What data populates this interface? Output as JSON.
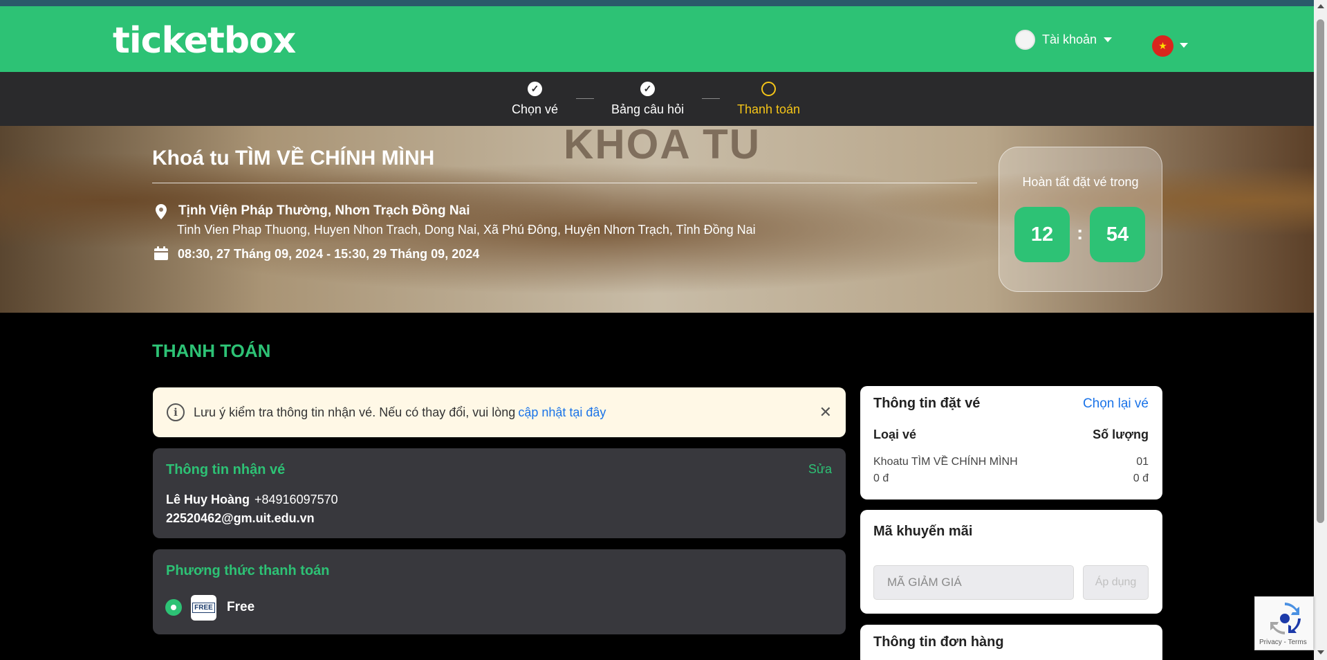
{
  "header": {
    "logo": "ticketbox",
    "account_label": "Tài khoản",
    "flag": "★"
  },
  "steps": [
    {
      "label": "Chọn vé",
      "status": "done",
      "mark": "✓"
    },
    {
      "label": "Bảng câu hỏi",
      "status": "done",
      "mark": "✓"
    },
    {
      "label": "Thanh toán",
      "status": "active",
      "mark": ""
    }
  ],
  "event": {
    "banner_text": "KHOA TU",
    "title": "Khoá tu TÌM VỀ CHÍNH MÌNH",
    "venue": "Tịnh Viện Pháp Thường, Nhơn Trạch Đồng Nai",
    "address": "Tinh Vien Phap Thuong, Huyen Nhon Trach, Dong Nai, Xã Phú Đông, Huyện Nhơn Trạch, Tỉnh Đồng Nai",
    "datetime": "08:30, 27 Tháng 09, 2024 - 15:30, 29 Tháng 09, 2024"
  },
  "timer": {
    "label": "Hoàn tất đặt vé trong",
    "minutes": "12",
    "separator": ":",
    "seconds": "54"
  },
  "page": {
    "section_title": "THANH TOÁN"
  },
  "notice": {
    "icon": "i",
    "text": "Lưu ý kiểm tra thông tin nhận vé. Nếu có thay đổi, vui lòng",
    "link": "cập nhật tại đây",
    "close": "✕"
  },
  "recipient": {
    "title": "Thông tin nhận vé",
    "edit": "Sửa",
    "name": "Lê Huy Hoàng",
    "phone": "+84916097570",
    "email": "22520462@gm.uit.edu.vn"
  },
  "payment": {
    "title": "Phương thức thanh toán",
    "logo_text": "FREE",
    "method": "Free"
  },
  "booking": {
    "title": "Thông tin đặt vé",
    "reselect": "Chọn lại vé",
    "col_type": "Loại vé",
    "col_qty": "Số lượng",
    "ticket_name": "Khoatu TÌM VỀ CHÍNH MÌNH",
    "ticket_qty": "01",
    "ticket_price": "0 đ",
    "ticket_total": "0 đ"
  },
  "promo": {
    "title": "Mã khuyến mãi",
    "placeholder": "MÃ GIẢM GIÁ",
    "apply": "Áp dụng"
  },
  "order": {
    "title": "Thông tin đơn hàng"
  },
  "recaptcha": {
    "text": "Privacy - Terms"
  },
  "colors": {
    "brand": "#2dc275",
    "active_step": "#f5c518",
    "link": "#1a73e8"
  }
}
